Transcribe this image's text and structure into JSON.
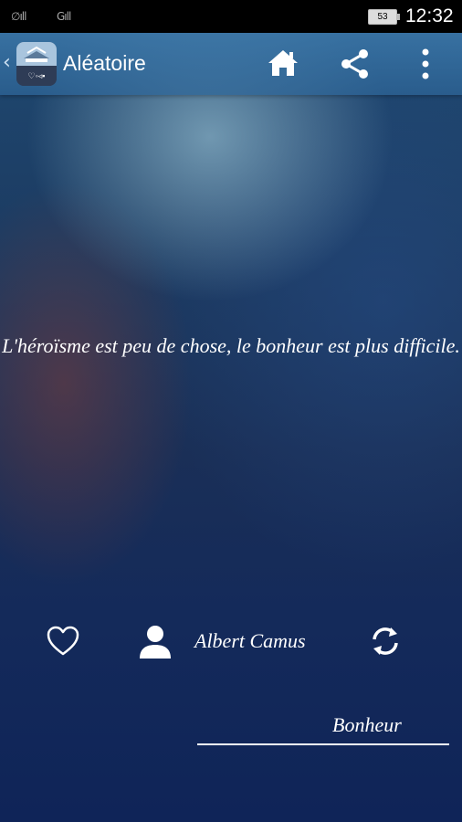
{
  "status_bar": {
    "signal1": "∅ıll",
    "signal2": "Gıll",
    "battery": "53",
    "time": "12:32"
  },
  "app_bar": {
    "title": "Aléatoire",
    "icons": [
      "back-chevron-icon",
      "app-logo",
      "home-icon",
      "share-icon",
      "more-vert-icon"
    ]
  },
  "quote": {
    "text": "L'héroïsme est peu de chose, le bonheur est plus difficile."
  },
  "actions": {
    "favorite_icon": "heart-outline-icon",
    "author_icon": "person-icon",
    "author": "Albert Camus",
    "refresh_icon": "refresh-icon"
  },
  "category": {
    "label": "Bonheur"
  },
  "colors": {
    "app_bar": "#3c78aa",
    "text": "#ffffff"
  }
}
